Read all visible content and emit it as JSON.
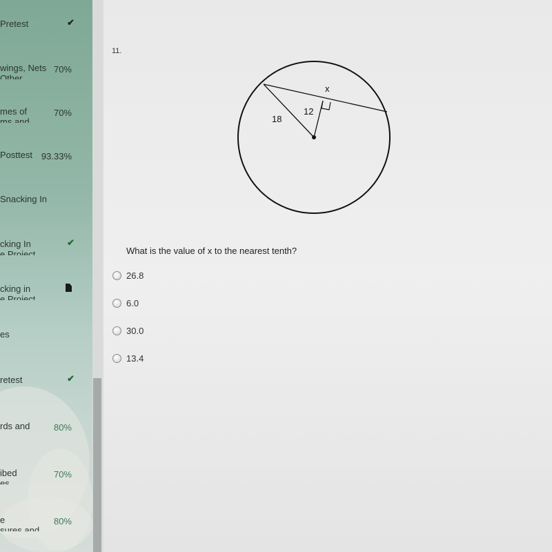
{
  "sidebar": {
    "items": [
      {
        "line1": "Pretest",
        "line2": "",
        "status": "check-icon"
      },
      {
        "line1": "wings, Nets",
        "line2": "Other",
        "status": "70%"
      },
      {
        "line1": "mes of",
        "line2": "ms and",
        "status": "70%"
      },
      {
        "line1": "Posttest",
        "line2": "",
        "status": "93.33%"
      },
      {
        "line1": "Snacking In",
        "line2": "",
        "status": ""
      },
      {
        "line1": "cking In",
        "line2": "e Project",
        "status": "check-icon"
      },
      {
        "line1": "cking in",
        "line2": "e Project",
        "status": "file-icon"
      },
      {
        "line1": "es",
        "line2": "",
        "status": ""
      },
      {
        "line1": "retest",
        "line2": "",
        "status": "check-icon"
      },
      {
        "line1": "rds and",
        "line2": "",
        "status": "80%"
      },
      {
        "line1": "ibed",
        "line2": "es",
        "status": "70%"
      },
      {
        "line1": "e",
        "line2": "sures and",
        "status": "80%"
      }
    ]
  },
  "question": {
    "number": "11.",
    "figure_labels": {
      "chord_part": "x",
      "perpendicular": "12",
      "radius": "18"
    },
    "text": "What is the value of x to the nearest tenth?",
    "options": [
      "26.8",
      "6.0",
      "30.0",
      "13.4"
    ]
  }
}
